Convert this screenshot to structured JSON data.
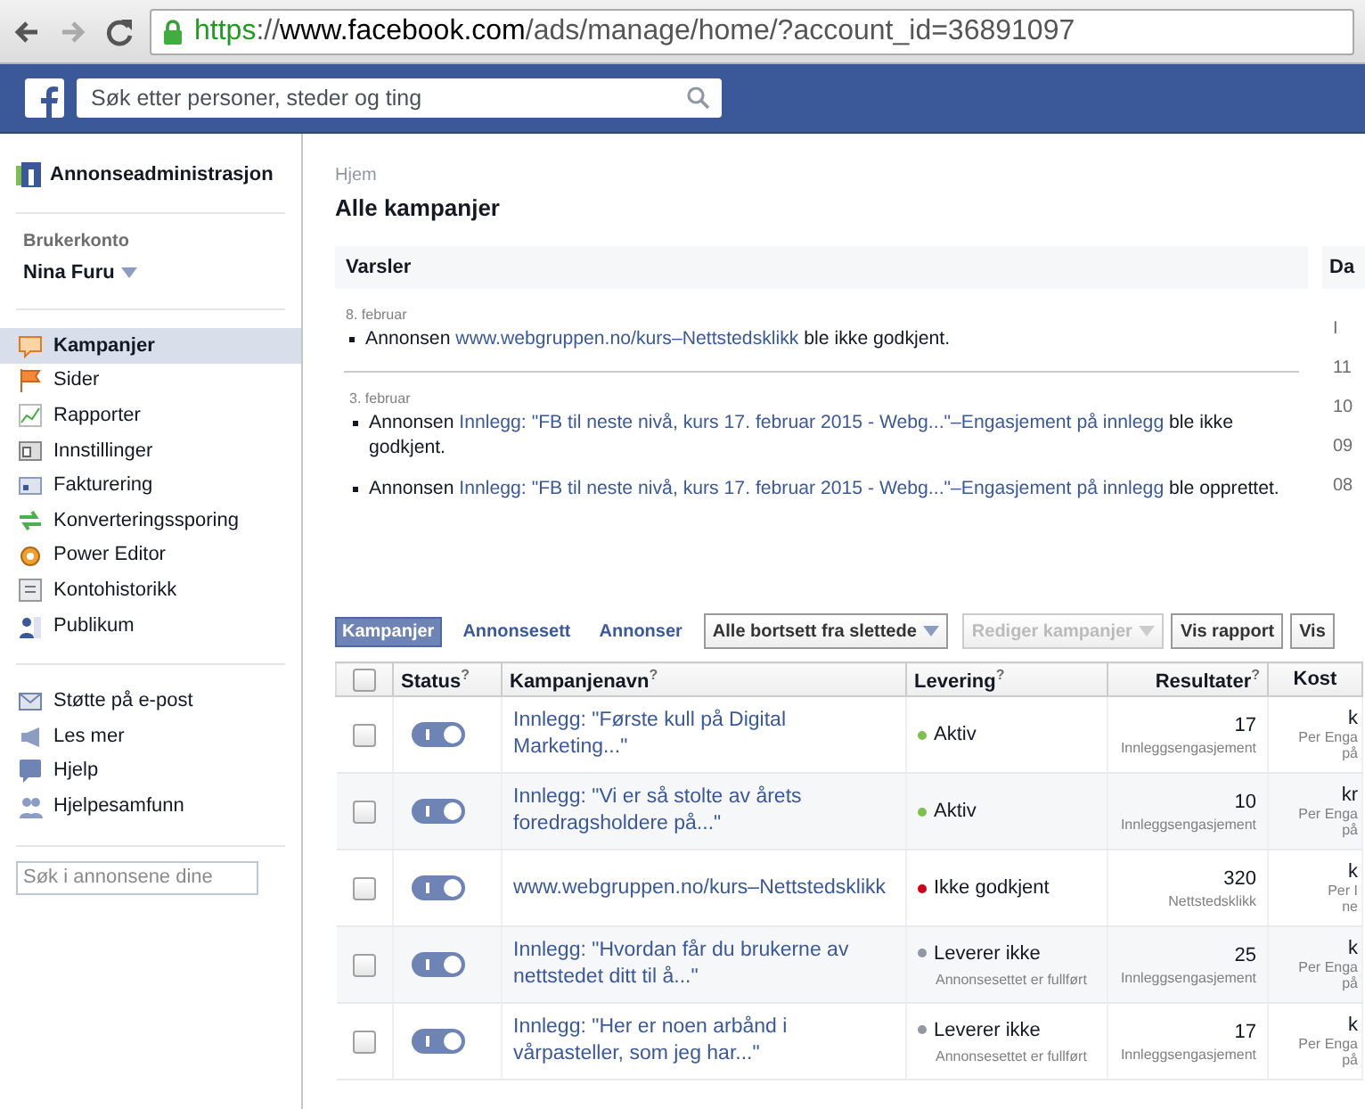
{
  "browser": {
    "url": [
      {
        "text": "https",
        "kind": "scheme"
      },
      {
        "text": "://",
        "kind": "path"
      },
      {
        "text": "www.facebook.com",
        "kind": "host"
      },
      {
        "text": "/ads/manage/home/?account_id=36891097",
        "kind": "path"
      }
    ]
  },
  "topbar": {
    "search": {
      "placeholder": "Søk etter personer, steder og ting"
    }
  },
  "sidebar": {
    "title": "Annonseadministrasjon",
    "account_label": "Brukerkonto",
    "account_name": "Nina Furu",
    "items": [
      {
        "label": "Kampanjer",
        "selected": true
      },
      {
        "label": "Sider",
        "selected": false
      },
      {
        "label": "Rapporter",
        "selected": false
      },
      {
        "label": "Innstillinger",
        "selected": false
      },
      {
        "label": "Fakturering",
        "selected": false
      },
      {
        "label": "Konverteringssporing",
        "selected": false
      },
      {
        "label": "Power Editor",
        "selected": false
      },
      {
        "label": "Kontohistorikk",
        "selected": false
      },
      {
        "label": "Publikum",
        "selected": false
      }
    ],
    "help_items": [
      {
        "label": "Støtte på e-post"
      },
      {
        "label": "Les mer"
      },
      {
        "label": "Hjelp"
      },
      {
        "label": "Hjelpesamfunn"
      }
    ],
    "search": {
      "placeholder": "Søk i annonsene dine"
    }
  },
  "breadcrumb": "Hjem",
  "page_title": "Alle kampanjer",
  "notifications": {
    "title": "Varsler",
    "groups": [
      {
        "date": "8. februar",
        "items": [
          [
            {
              "text": "Annonsen ",
              "kind": "plain"
            },
            {
              "text": "www.webgruppen.no/kurs–Nettstedsklikk",
              "kind": "link"
            },
            {
              "text": " ble ikke godkjent.",
              "kind": "plain"
            }
          ]
        ]
      },
      {
        "date": "3. februar",
        "items": [
          [
            {
              "text": "Annonsen ",
              "kind": "plain"
            },
            {
              "text": "Innlegg: \"FB til neste nivå, kurs 17. februar 2015 - Webg...\"–Engasjement på innlegg",
              "kind": "link"
            },
            {
              "text": " ble ikke godkjent.",
              "kind": "plain"
            }
          ],
          [
            {
              "text": "Annonsen ",
              "kind": "plain"
            },
            {
              "text": "Innlegg: \"FB til neste nivå, kurs 17. februar 2015 - Webg...\"–Engasjement på innlegg",
              "kind": "link"
            },
            {
              "text": " ble opprettet.",
              "kind": "plain"
            }
          ]
        ]
      }
    ]
  },
  "side_panel": {
    "title": "Da",
    "lines": [
      "I",
      "11",
      "10",
      "09",
      "08"
    ]
  },
  "tabs": [
    {
      "label": "Kampanjer",
      "selected": true
    },
    {
      "label": "Annonsesett",
      "selected": false
    },
    {
      "label": "Annonser",
      "selected": false
    }
  ],
  "toolbar": [
    {
      "label": "Alle bortsett fra slettede",
      "kind": "dropdown",
      "disabled": false
    },
    {
      "label": "Rediger kampanjer",
      "kind": "dropdown",
      "disabled": true
    },
    {
      "label": "Vis rapport",
      "kind": "button",
      "disabled": false
    },
    {
      "label": "Vis",
      "kind": "button",
      "disabled": false
    }
  ],
  "table": {
    "select_all": {
      "checked": false
    },
    "columns": [
      {
        "label": "Status",
        "help": "?"
      },
      {
        "label": "Kampanjenavn",
        "help": "?"
      },
      {
        "label": "Levering",
        "help": "?"
      },
      {
        "label": "Resultater",
        "help": "?"
      },
      {
        "label": "Kost"
      }
    ],
    "rows": [
      {
        "checked": false,
        "on": true,
        "name": "Innlegg: \"Første kull på Digital Marketing...\"",
        "delivery": "Aktiv",
        "color": "#7fbf4d",
        "result": "17",
        "result_label": "Innleggsengasjement",
        "cost": [
          "k",
          "Per Enga",
          "på"
        ]
      },
      {
        "checked": false,
        "on": true,
        "name": "Innlegg: \"Vi er så stolte av årets foredragsholdere på...\"",
        "delivery": "Aktiv",
        "color": "#7fbf4d",
        "result": "10",
        "result_label": "Innleggsengasjement",
        "cost": [
          "kr",
          "Per Enga",
          "på"
        ]
      },
      {
        "checked": false,
        "on": true,
        "name": "www.webgruppen.no/kurs–Nettstedsklikk",
        "delivery": "Ikke godkjent",
        "color": "#d0021b",
        "result": "320",
        "result_label": "Nettstedsklikk",
        "cost": [
          "k",
          "Per I",
          "ne"
        ]
      },
      {
        "checked": false,
        "on": true,
        "name": "Innlegg: \"Hvordan får du brukerne av nettstedet ditt til å...\"",
        "delivery": "Leverer ikke",
        "color": "#9197a3",
        "delivery_note": "Annonsesettet er fullført",
        "result": "25",
        "result_label": "Innleggsengasjement",
        "cost": [
          "k",
          "Per Enga",
          "på"
        ]
      },
      {
        "checked": false,
        "on": true,
        "name": "Innlegg: \"Her er noen arbånd i vårpasteller, som jeg har...\"",
        "delivery": "Leverer ikke",
        "color": "#9197a3",
        "delivery_note": "Annonsesettet er fullført",
        "result": "17",
        "result_label": "Innleggsengasjement",
        "cost": [
          "k",
          "Per Enga",
          "på"
        ]
      }
    ]
  }
}
